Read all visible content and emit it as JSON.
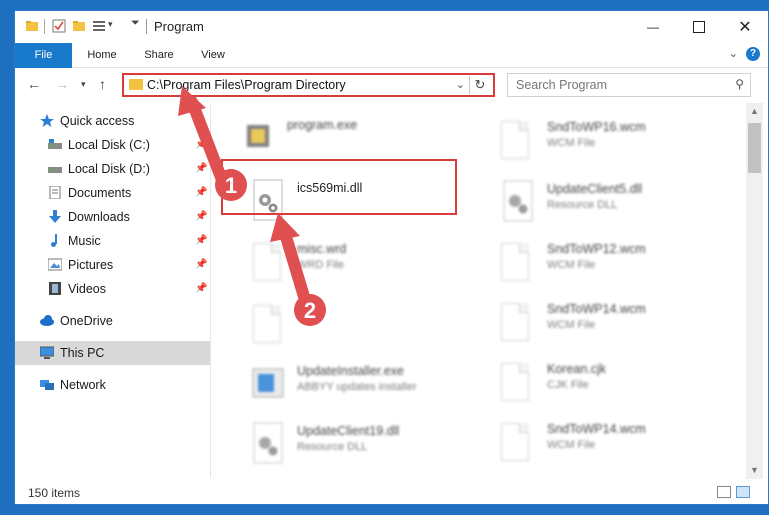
{
  "window": {
    "title": "Program"
  },
  "ribbon": {
    "tabs": [
      "File",
      "Home",
      "Share",
      "View"
    ],
    "help": "?"
  },
  "address": {
    "path": "C:\\Program Files\\Program Directory",
    "search_placeholder": "Search Program"
  },
  "sidebar": {
    "items": [
      {
        "label": "Quick access",
        "icon": "star-icon"
      },
      {
        "label": "Local Disk (C:)",
        "icon": "drive-icon"
      },
      {
        "label": "Local Disk (D:)",
        "icon": "drive-icon"
      },
      {
        "label": "Documents",
        "icon": "documents-icon"
      },
      {
        "label": "Downloads",
        "icon": "download-icon"
      },
      {
        "label": "Music",
        "icon": "music-icon"
      },
      {
        "label": "Pictures",
        "icon": "pictures-icon"
      },
      {
        "label": "Videos",
        "icon": "videos-icon"
      },
      {
        "label": "OneDrive",
        "icon": "cloud-icon"
      },
      {
        "label": "This PC",
        "icon": "computer-icon"
      },
      {
        "label": "Network",
        "icon": "network-icon"
      }
    ]
  },
  "files": [
    {
      "name": "program.exe",
      "type": ""
    },
    {
      "name": "SndToWP16.wcm",
      "type": "WCM File"
    },
    {
      "name": "ics569mi.dll",
      "type": ""
    },
    {
      "name": "UpdateClient5.dll",
      "type": "Resource DLL"
    },
    {
      "name": "misc.wrd",
      "type": "WRD File"
    },
    {
      "name": "SndToWP12.wcm",
      "type": "WCM File"
    },
    {
      "name": "SndToWP14.wcm",
      "type": "WCM File"
    },
    {
      "name": "UpdateInstaller.exe",
      "type": "ABBYY updates installer"
    },
    {
      "name": "Korean.cjk",
      "type": "CJK File"
    },
    {
      "name": "UpdateClient19.dll",
      "type": "Resource DLL"
    },
    {
      "name": "SndToWP14.wcm",
      "type": "WCM File"
    }
  ],
  "status": {
    "count": "150 items"
  },
  "annotations": {
    "step1": "1",
    "step2": "2"
  },
  "colors": {
    "accent": "#1979ca",
    "highlight": "#d93b3b"
  }
}
